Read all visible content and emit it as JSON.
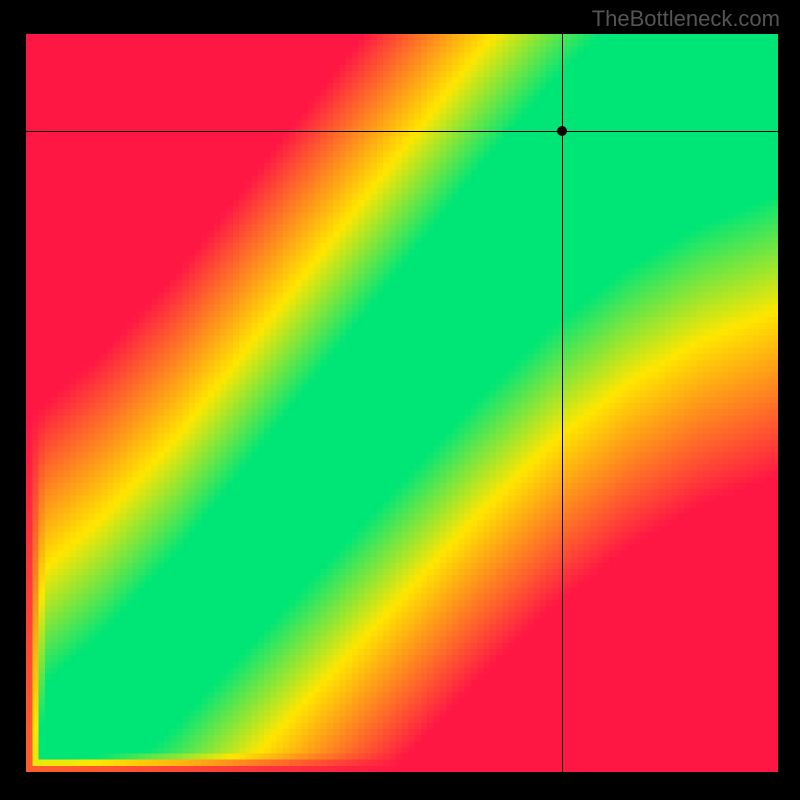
{
  "watermark": "TheBottleneck.com",
  "chart_data": {
    "type": "heatmap",
    "title": "",
    "xlabel": "",
    "ylabel": "",
    "xlim": [
      0,
      100
    ],
    "ylim": [
      0,
      100
    ],
    "crosshair": {
      "x": 71.3,
      "y": 86.9
    },
    "marker": {
      "x": 71.3,
      "y": 86.9
    },
    "optimal_curve": [
      {
        "x": 0,
        "y": 0
      },
      {
        "x": 10,
        "y": 8
      },
      {
        "x": 20,
        "y": 18
      },
      {
        "x": 30,
        "y": 30
      },
      {
        "x": 40,
        "y": 42
      },
      {
        "x": 50,
        "y": 54
      },
      {
        "x": 60,
        "y": 66
      },
      {
        "x": 70,
        "y": 77
      },
      {
        "x": 80,
        "y": 86
      },
      {
        "x": 90,
        "y": 93
      },
      {
        "x": 100,
        "y": 98
      }
    ],
    "color_stops": [
      {
        "t": 0.0,
        "color": "#ff1744"
      },
      {
        "t": 0.5,
        "color": "#ffe600"
      },
      {
        "t": 0.85,
        "color": "#00e676"
      },
      {
        "t": 1.0,
        "color": "#00e676"
      }
    ],
    "grid_size": 120
  }
}
